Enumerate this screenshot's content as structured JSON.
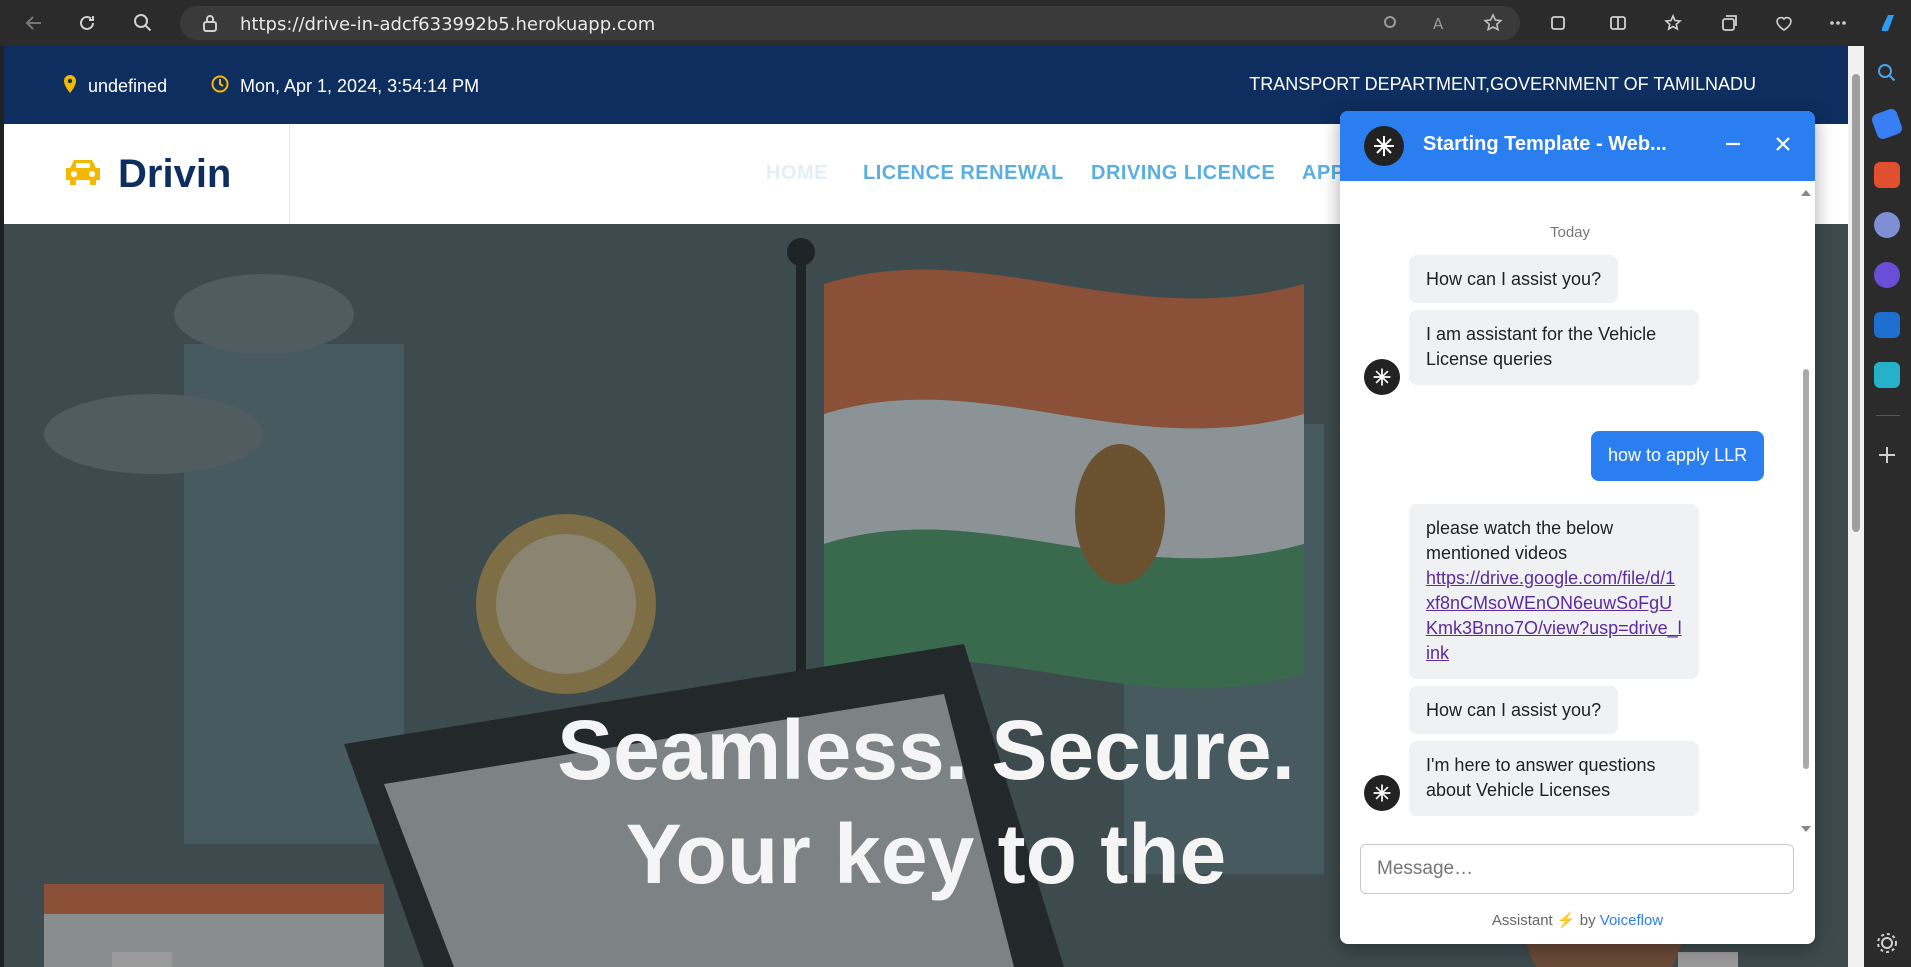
{
  "browser": {
    "url": "https://drive-in-adcf633992b5.herokuapp.com"
  },
  "topbar": {
    "location": "undefined",
    "datetime": "Mon, Apr 1, 2024, 3:54:14 PM",
    "department": "TRANSPORT DEPARTMENT,GOVERNMENT OF TAMILNADU"
  },
  "brand": {
    "name": "Drivin",
    "accent": "#f5b800"
  },
  "menu": {
    "items": [
      {
        "label": "HOME"
      },
      {
        "label": "LICENCE RENEWAL"
      },
      {
        "label": "DRIVING LICENCE"
      },
      {
        "label": "APP"
      }
    ]
  },
  "hero": {
    "line1": "Seamless. Secure.",
    "line2": "Your key to the"
  },
  "chat": {
    "title": "Starting Template - Web...",
    "date_label": "Today",
    "messages": [
      {
        "from": "bot",
        "text": "How can I assist you?"
      },
      {
        "from": "bot",
        "text": "I am assistant for the Vehicle License queries"
      },
      {
        "from": "user",
        "text": "how to apply LLR"
      },
      {
        "from": "bot",
        "text": "please watch the below mentioned videos",
        "link": "https://drive.google.com/file/d/1xf8nCMsoWEnON6euwSoFgUKmk3Bnno7O/view?usp=drive_link"
      },
      {
        "from": "bot",
        "text": "How can I assist you?"
      },
      {
        "from": "bot",
        "text": "I'm here to answer questions about Vehicle Licenses"
      }
    ],
    "input_placeholder": "Message…",
    "footer_prefix": "Assistant",
    "footer_by": "by",
    "footer_brand": "Voiceflow",
    "header_color": "#2b7ef0"
  },
  "colors": {
    "topbar_bg": "#0d2e5e",
    "menu_text": "#5aaee0"
  }
}
